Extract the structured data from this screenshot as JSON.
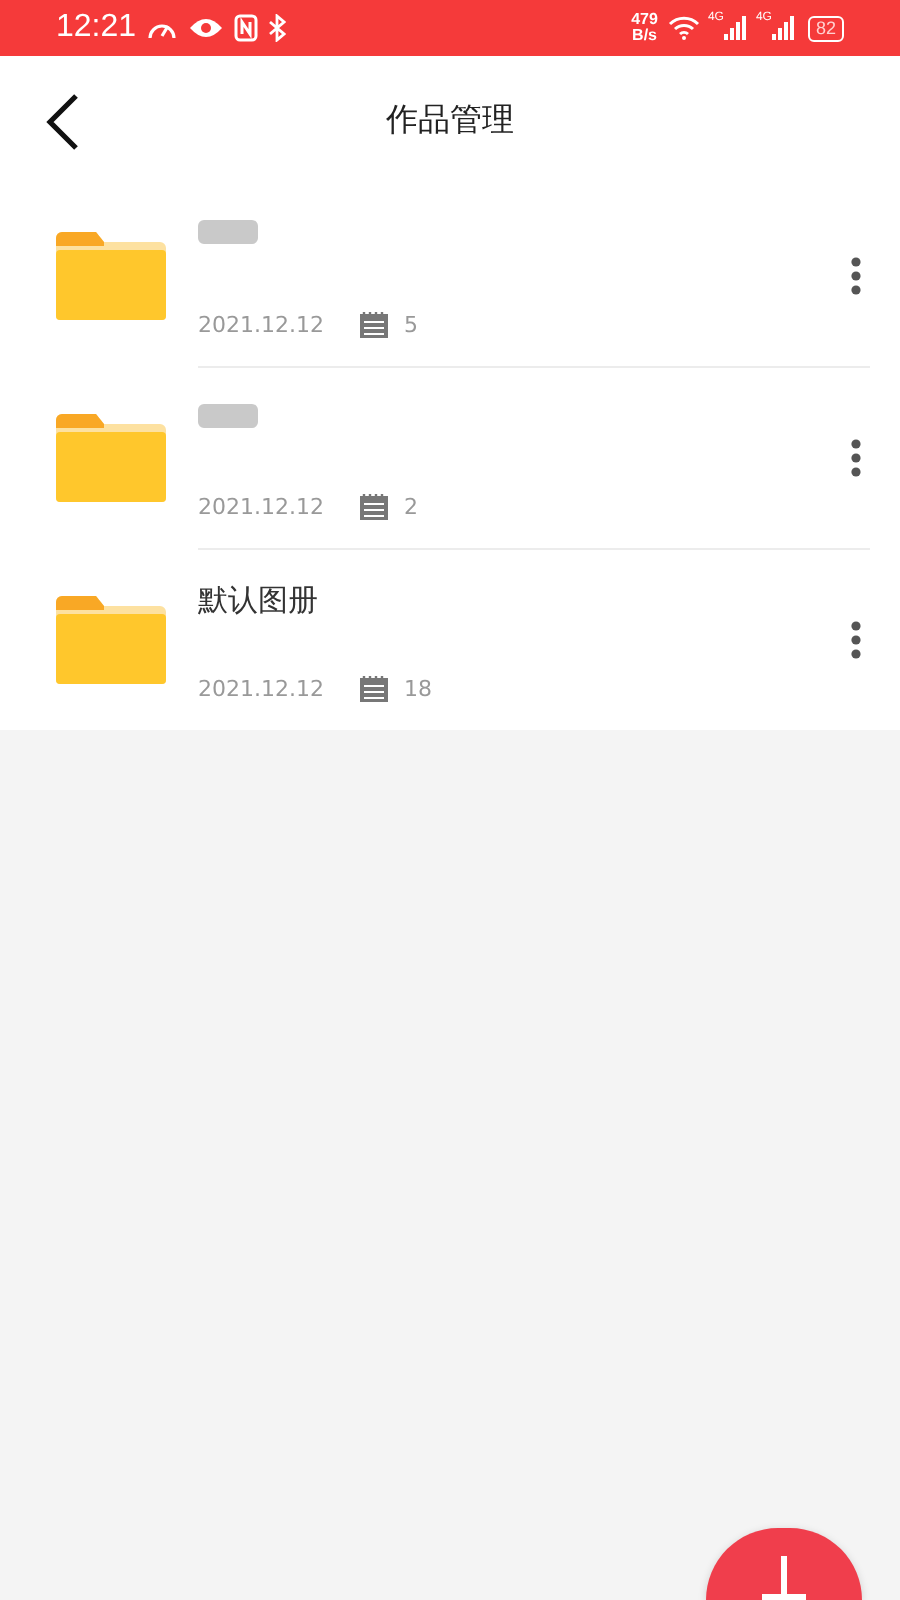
{
  "status_bar": {
    "time": "12:21",
    "speed_value": "479",
    "speed_unit": "B/s",
    "network_1": "4G",
    "network_2": "4G",
    "battery": "82"
  },
  "header": {
    "title": "作品管理"
  },
  "albums": [
    {
      "redacted": true,
      "date": "2021.12.12",
      "count": "5"
    },
    {
      "redacted": true,
      "date": "2021.12.12",
      "count": "2"
    },
    {
      "name": "默认图册",
      "redacted": false,
      "date": "2021.12.12",
      "count": "18"
    }
  ]
}
